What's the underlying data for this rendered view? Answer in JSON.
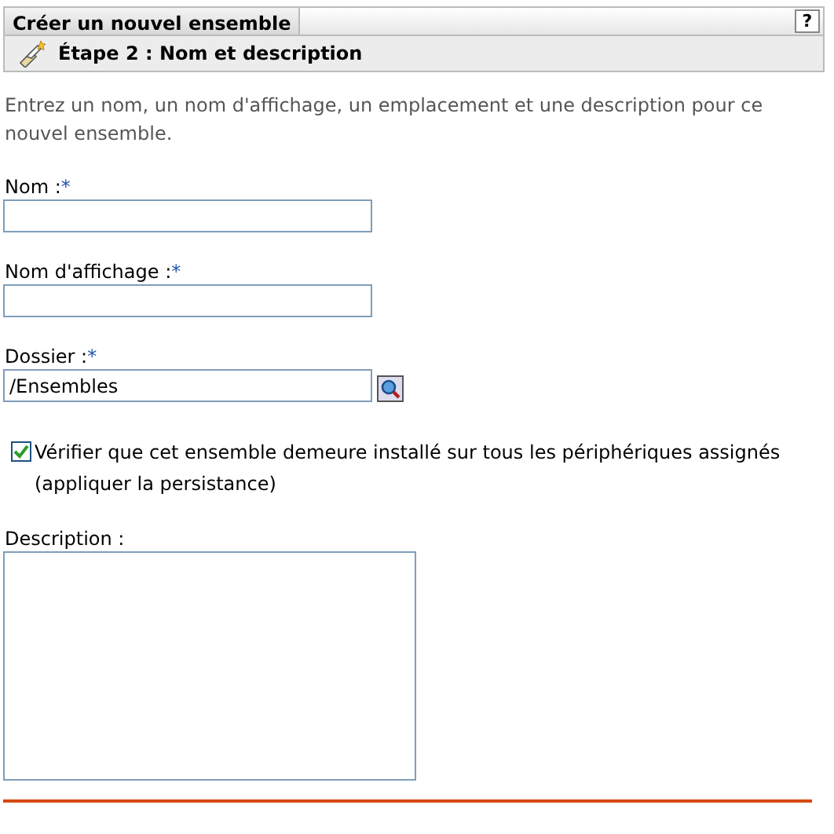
{
  "panel": {
    "title": "Créer un nouvel ensemble",
    "help": "?"
  },
  "step": {
    "title": "Étape 2 : Nom et description"
  },
  "intro": "Entrez un nom, un nom d'affichage, un emplacement et une description pour ce nouvel ensemble.",
  "fields": [
    {
      "kind": "text",
      "label": "Nom :",
      "required_mark": "*"
    },
    {
      "kind": "text",
      "label": "Nom d'affichage :",
      "required_mark": "*"
    },
    {
      "kind": "browse",
      "label": "Dossier :",
      "required_mark": "*",
      "value": "/Ensembles"
    },
    {
      "kind": "checkbox",
      "label": "Vérifier que cet ensemble demeure installé sur tous les périphériques assignés (appliquer la persistance)",
      "checked": true
    },
    {
      "kind": "textarea",
      "label": "Description :"
    }
  ]
}
